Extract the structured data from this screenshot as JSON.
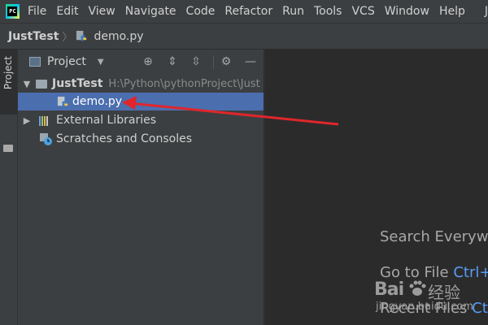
{
  "menubar": {
    "logo_text": "PC",
    "items": [
      "File",
      "Edit",
      "View",
      "Navigate",
      "Code",
      "Refactor",
      "Run",
      "Tools",
      "VCS",
      "Window",
      "Help"
    ],
    "overflow": "J"
  },
  "breadcrumb": {
    "project": "JustTest",
    "file": "demo.py"
  },
  "toolstrip": {
    "project_tab": "Project"
  },
  "panel": {
    "title": "Project",
    "tree": {
      "root_name": "JustTest",
      "root_path": "H:\\Python\\pythonProject\\Just",
      "file": "demo.py",
      "external": "External Libraries",
      "scratches": "Scratches and Consoles"
    }
  },
  "editor": {
    "hint1": "Search Everywh",
    "hint2_label": "Go to File",
    "hint2_key": "Ctrl+",
    "hint3_label": "Recent Files",
    "hint3_key": "Ctrl"
  },
  "watermark": {
    "logo": "Bai",
    "logo_cn": "经验",
    "url": "jingyan.baidu.com"
  },
  "colors": {
    "background": "#2b2b2b",
    "panel": "#3c3f41",
    "selection": "#4b6eaf",
    "accent_key": "#589df6",
    "annotation": "#e0262b"
  }
}
